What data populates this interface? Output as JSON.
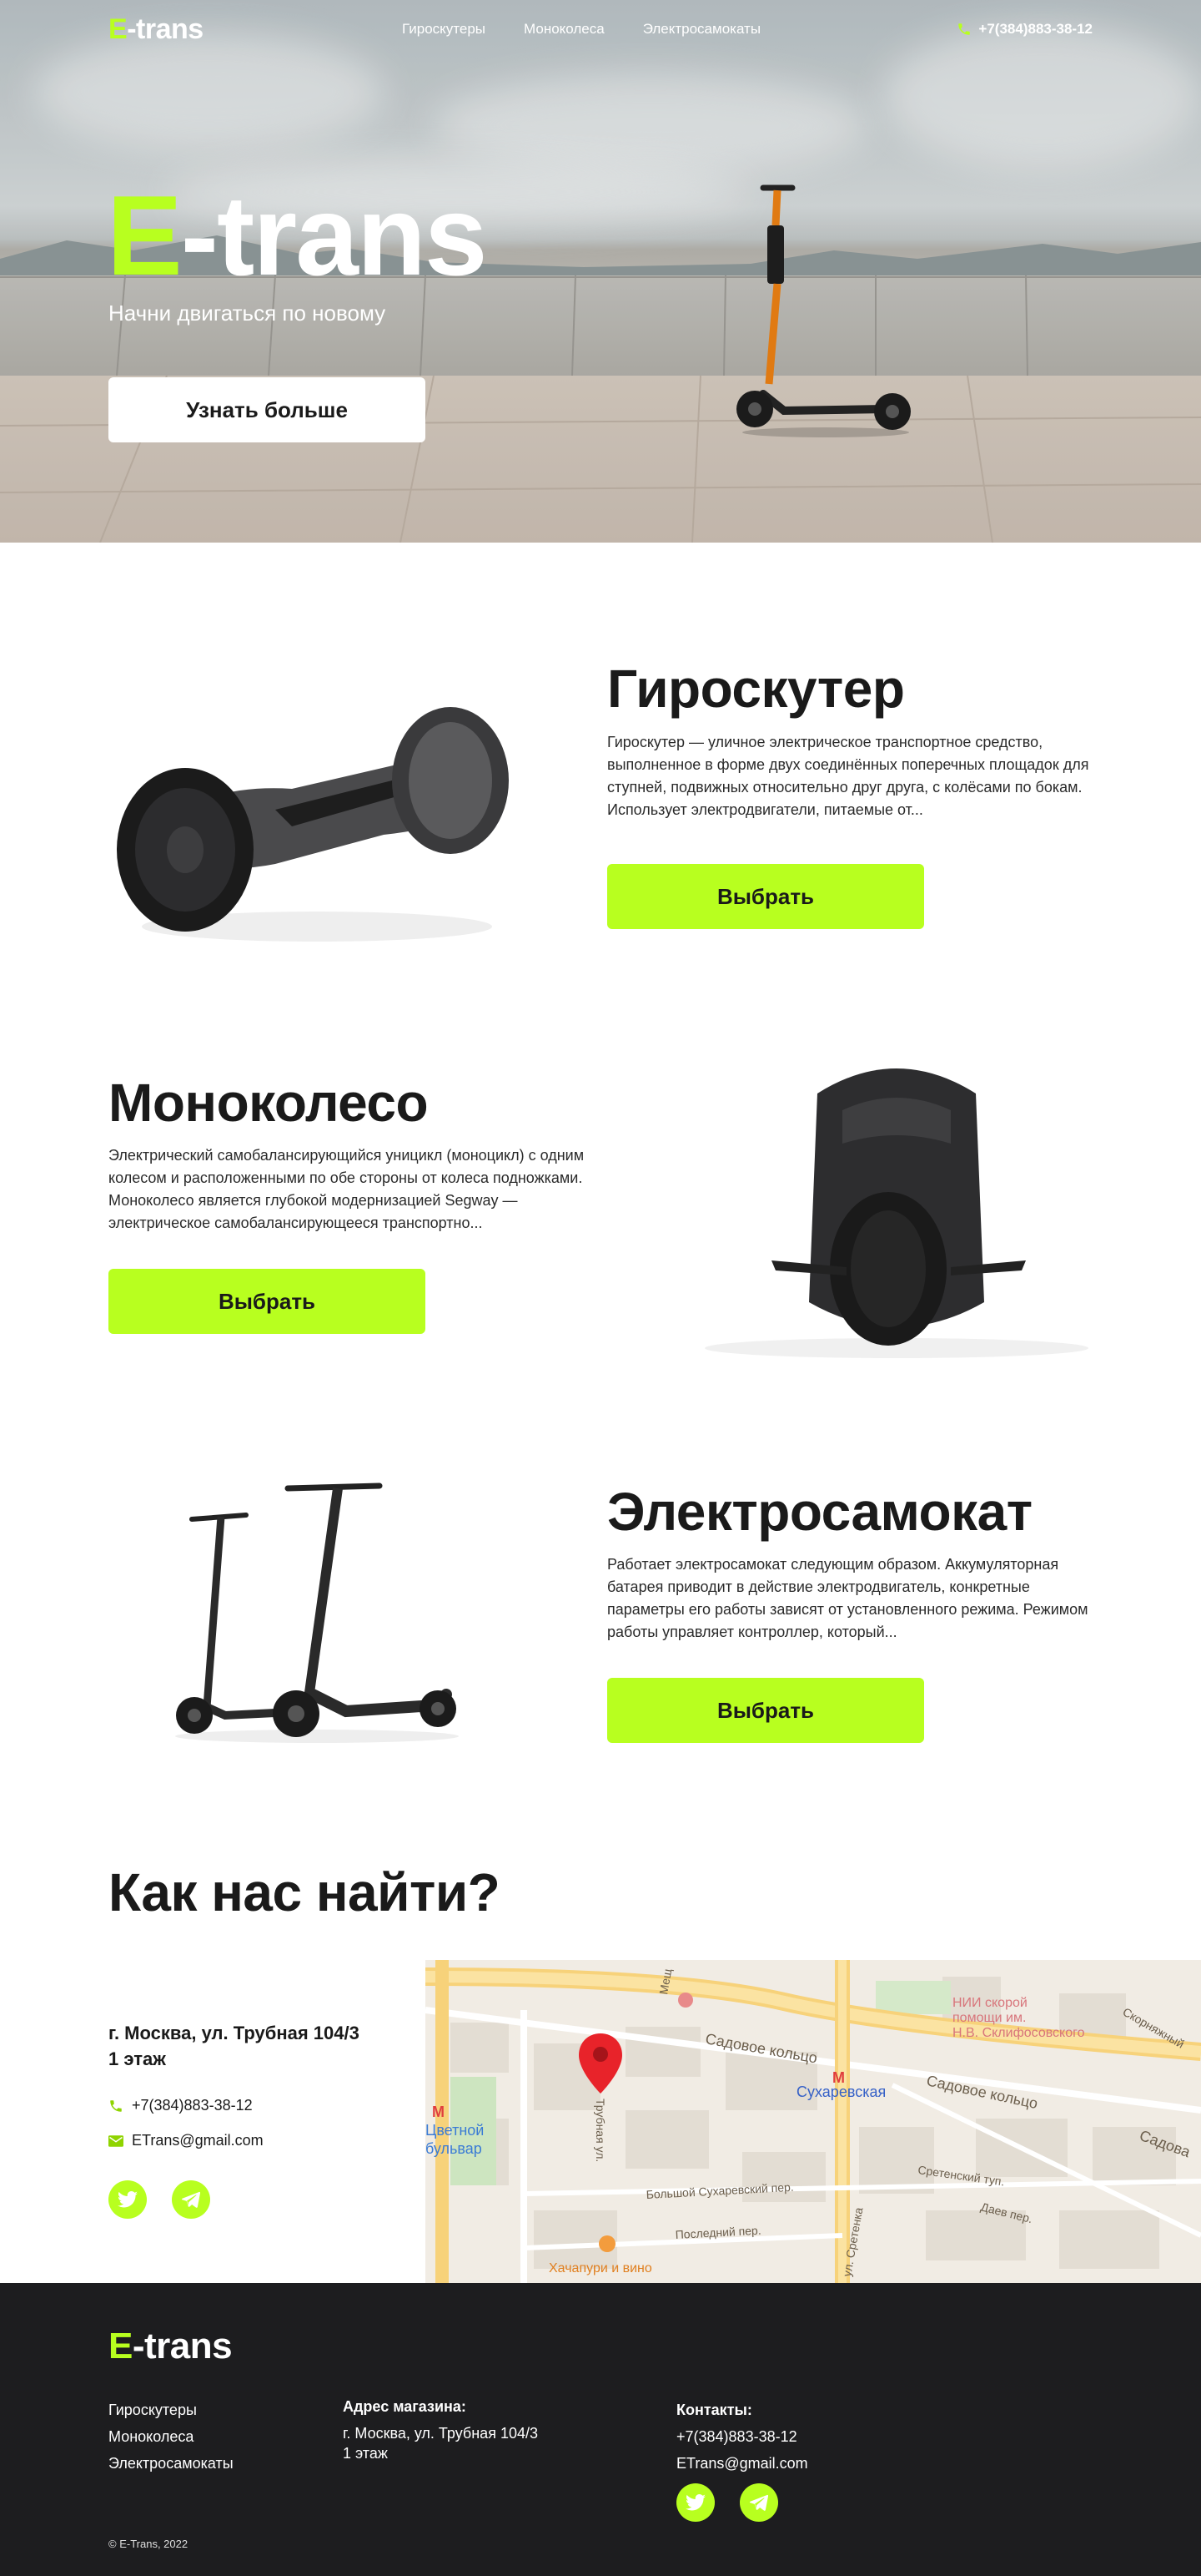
{
  "brand": {
    "logo_e": "E",
    "logo_rest": "-trans"
  },
  "nav": {
    "links": [
      "Гироскутеры",
      "Моноколеса",
      "Электросамокаты"
    ],
    "phone": "+7(384)883-38-12"
  },
  "hero": {
    "title_e": "E",
    "title_rest": "-trans",
    "subtitle": "Начни двигаться по новому",
    "button": "Узнать больше"
  },
  "products": [
    {
      "title": "Гироскутер",
      "description": "Гироскутер  — уличное электрическое транспортное средство, выполненное в форме двух соединённых поперечных площадок для ступней, подвижных относительно друг друга, с колёсами по бокам. Использует электродвигатели, питаемые от...",
      "button": "Выбрать"
    },
    {
      "title": "Моноколесо",
      "description": "Электрический самобалансирующийся уницикл (моноцикл) с одним колесом и расположенными по обе стороны от колеса подножками. Моноколесо является глубокой модернизацией Segway — электрическое самобалансирующееся транспортно...",
      "button": "Выбрать"
    },
    {
      "title": "Электросамокат",
      "description": "Работает электросамокат следующим образом. Аккумуляторная батарея приводит в действие электродвигатель, конкретные параметры его работы зависят от установленного режима. Режимом работы управляет контроллер, который...",
      "button": "Выбрать"
    }
  ],
  "find_us": {
    "title": "Как нас найти?",
    "address_line1": "г. Москва, ул. Трубная 104/3",
    "address_line2": "1 этаж",
    "phone": "+7(384)883-38-12",
    "email": "ETrans@gmail.com"
  },
  "map": {
    "labels": {
      "sadovoe1": "Садовое кольцо",
      "sadovoe2": "Садовое кольцо",
      "sadovaya": "Садова",
      "metro": "Сухаревская",
      "hospital1": "НИИ скорой",
      "hospital2": "помощи им.",
      "hospital3": "Н.В. Склифосовского",
      "tsvetnoy1": "Цветной",
      "tsvetnoy2": "бульвар",
      "trubnaya": "Трубная ул.",
      "bsukh": "Большой Сухаревский пер.",
      "posledniy": "Последний пер.",
      "sretenskiy": "Сретенский туп.",
      "sretenka": "ул. Сретенка",
      "daev": "Даев пер.",
      "meshch": "Мещ",
      "skornyy": "Скорняжный",
      "khachapuri": "Хачапури и вино"
    }
  },
  "footer": {
    "nav": [
      "Гироскутеры",
      "Моноколеса",
      "Электросамокаты"
    ],
    "address_heading": "Адрес магазина:",
    "address_line1": "г. Москва, ул. Трубная 104/3",
    "address_line2": "1 этаж",
    "contacts_heading": "Контакты:",
    "phone": "+7(384)883-38-12",
    "email": "ETrans@gmail.com",
    "copyright": "© E-Trans, 2022"
  },
  "colors": {
    "accent": "#b8ff1f",
    "dark": "#1d1d1f",
    "text": "#1a1a1a"
  }
}
